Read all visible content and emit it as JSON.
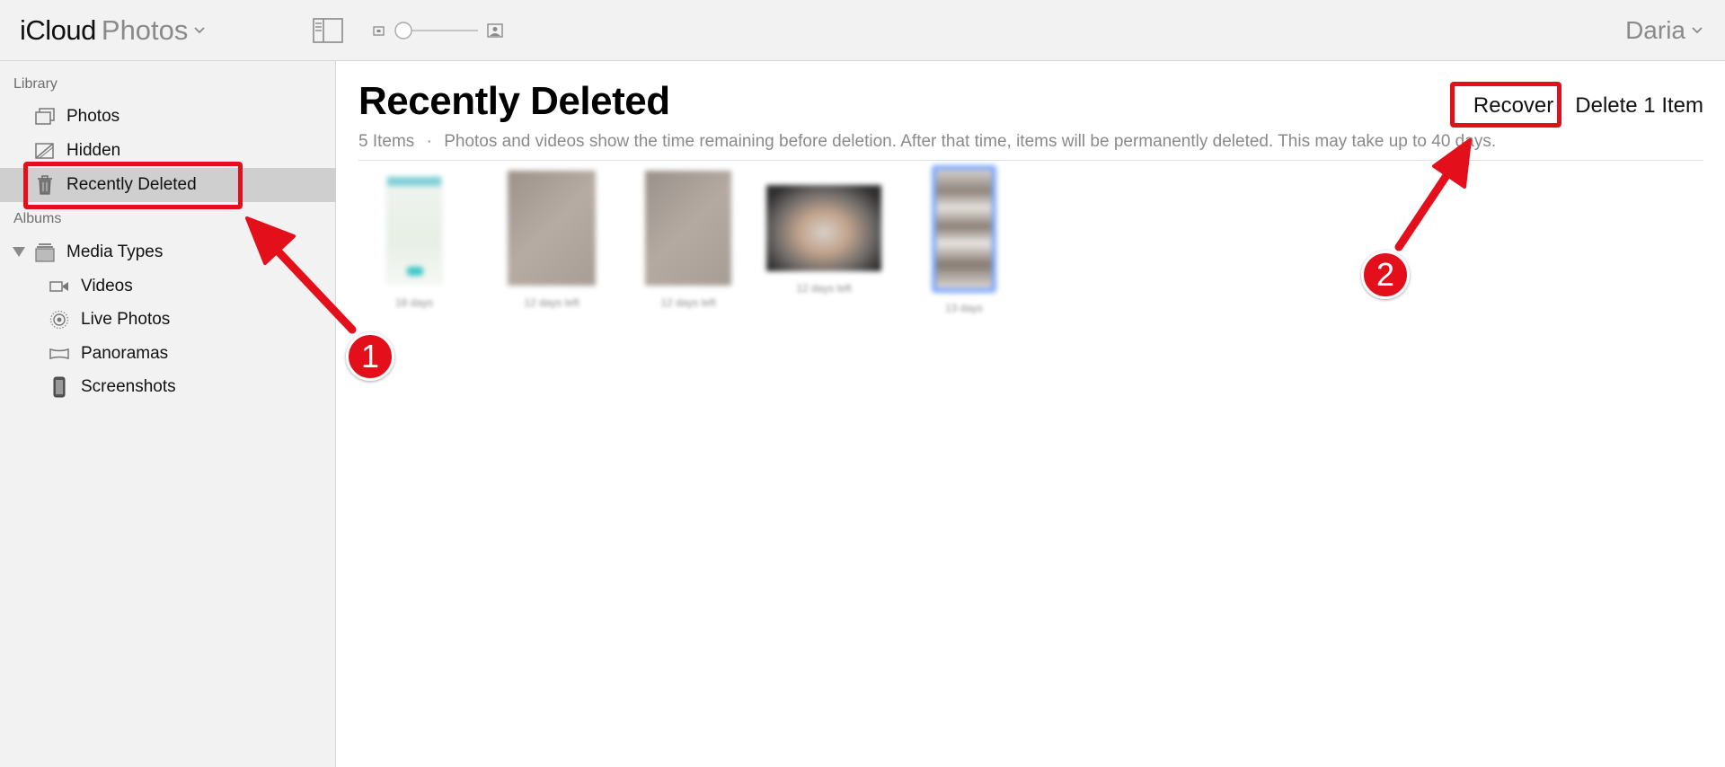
{
  "app": {
    "brand_primary": "iCloud",
    "brand_secondary": "Photos"
  },
  "user": {
    "name": "Daria"
  },
  "sidebar": {
    "library_label": "Library",
    "library_items": [
      {
        "label": "Photos",
        "icon": "photos-stack-icon"
      },
      {
        "label": "Hidden",
        "icon": "hidden-icon"
      },
      {
        "label": "Recently Deleted",
        "icon": "trash-icon",
        "selected": true
      }
    ],
    "albums_label": "Albums",
    "media_types": {
      "label": "Media Types",
      "icon": "media-types-icon",
      "expanded": true
    },
    "media_type_items": [
      {
        "label": "Videos",
        "icon": "video-camera-icon"
      },
      {
        "label": "Live Photos",
        "icon": "live-photo-icon"
      },
      {
        "label": "Panoramas",
        "icon": "panorama-icon"
      },
      {
        "label": "Screenshots",
        "icon": "screenshot-icon"
      }
    ]
  },
  "main": {
    "title": "Recently Deleted",
    "item_count": "5 Items",
    "separator": "·",
    "description": "Photos and videos show the time remaining before deletion. After that time, items will be permanently deleted. This may take up to 40 days.",
    "recover_label": "Recover",
    "delete_label": "Delete 1 Item",
    "thumbnails": [
      {
        "caption": "18 days",
        "kind": "screenshot"
      },
      {
        "caption": "12 days left",
        "kind": "photo"
      },
      {
        "caption": "12 days left",
        "kind": "photo"
      },
      {
        "caption": "12 days left",
        "kind": "photo"
      },
      {
        "caption": "13 days",
        "kind": "screenshot",
        "selected": true
      }
    ]
  },
  "annotations": {
    "step1": "1",
    "step2": "2"
  },
  "colors": {
    "accent_red": "#e3101b",
    "sidebar_bg": "#f2f2f2",
    "selection_bg": "#cfcfcf",
    "selection_blue": "#7aa7ff"
  }
}
